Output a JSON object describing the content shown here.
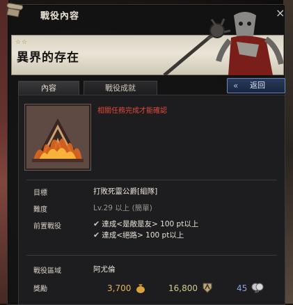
{
  "window": {
    "title": "戰役內容",
    "close_label": "×"
  },
  "banner": {
    "stars": "☆☆",
    "title": "異界的存在"
  },
  "tabs": [
    {
      "label": "內容",
      "active": true
    },
    {
      "label": "戰役成就",
      "active": false
    }
  ],
  "back_button": {
    "chevron": "«",
    "label": "返回"
  },
  "quest": {
    "icon": "flaming-camp-icon",
    "requirement_note": "相關任務完成才能確認"
  },
  "details": {
    "objective_label": "目標",
    "objective_value": "打敗死靈公爵[組隊]",
    "difficulty_label": "難度",
    "difficulty_value": "Lv.29 以上 (簡單)",
    "prereq_label": "前置戰役",
    "prereqs": [
      "達成<是敵是友> 100 pt以上",
      "達成<絕路> 100 pt以上"
    ],
    "region_label": "戰役區域",
    "region_value": "阿尤倫",
    "reward_label": "獎勵",
    "reward_gold": "3,700",
    "reward_exp": "16,800",
    "reward_ap": "45"
  },
  "colors": {
    "note_red": "#e04a3a",
    "gold": "#e0b35a",
    "back_button_border": "#6b86b8",
    "banner_bg": "#e9e4d6"
  }
}
